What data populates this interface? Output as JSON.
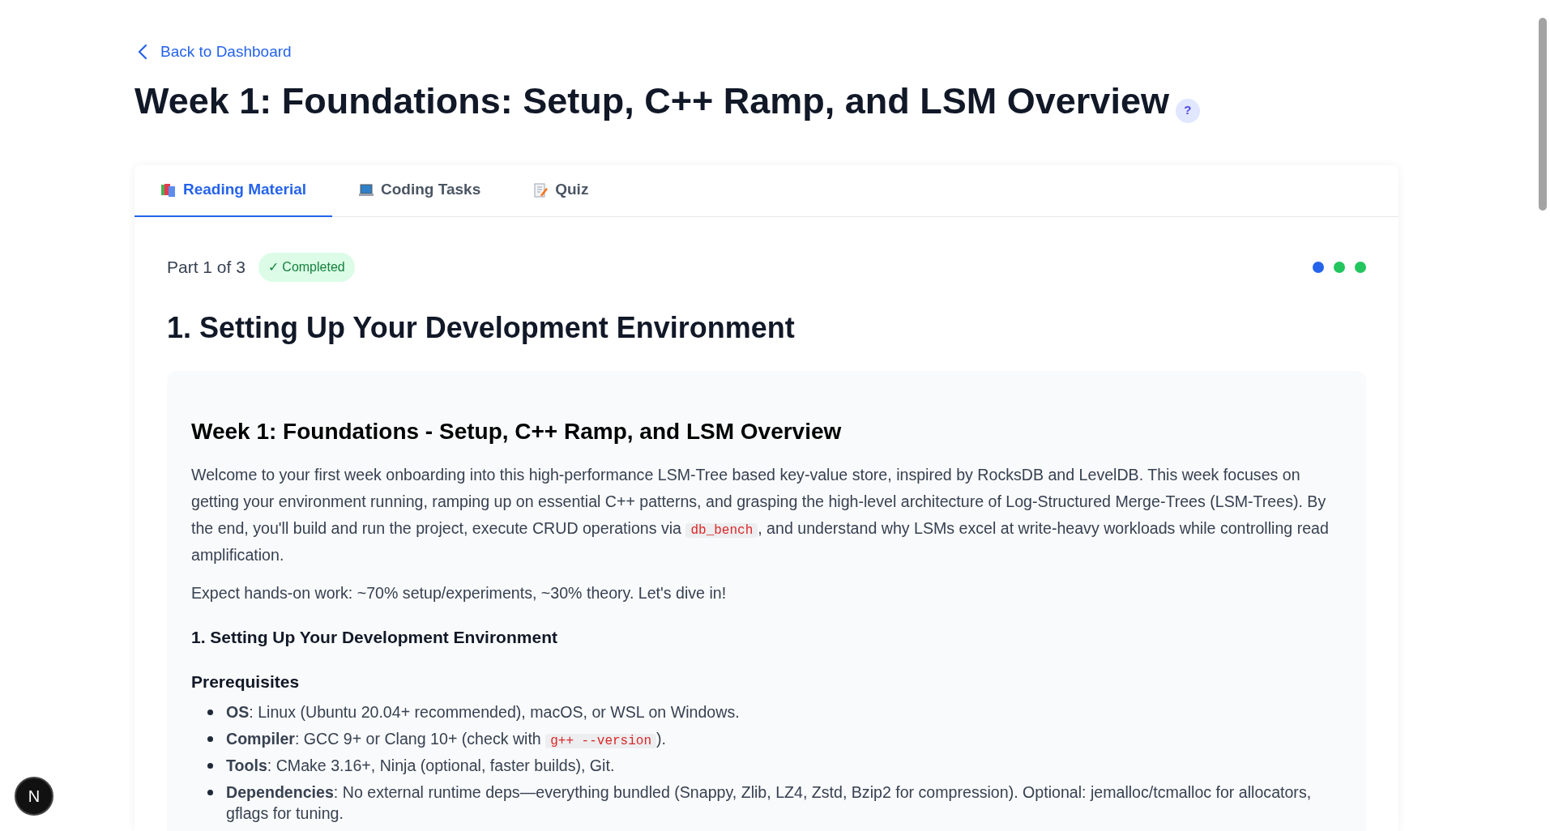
{
  "back_link": "Back to Dashboard",
  "title": "Week 1: Foundations: Setup, C++ Ramp, and LSM Overview",
  "help_badge": "?",
  "tabs": [
    {
      "label": "Reading Material",
      "kind": "books",
      "selected": true
    },
    {
      "label": "Coding Tasks",
      "kind": "laptop",
      "selected": false
    },
    {
      "label": "Quiz",
      "kind": "memo",
      "selected": false
    }
  ],
  "part": {
    "label": "Part 1 of 3",
    "status": "✓ Completed",
    "completed": true
  },
  "part_dots": [
    {
      "color": "#2563eb"
    },
    {
      "color": "#22c55e"
    },
    {
      "color": "#22c55e"
    }
  ],
  "section_title": "1. Setting Up Your Development Environment",
  "content": [
    {
      "kind": "h2",
      "segments": [
        {
          "kind": "text",
          "text": "Week 1: Foundations - Setup, C++ Ramp, and LSM Overview"
        }
      ]
    },
    {
      "kind": "p",
      "segments": [
        {
          "kind": "text",
          "text": "Welcome to your first week onboarding into this high-performance LSM-Tree based key-value store, inspired by RocksDB and LevelDB. This week focuses on getting your environment running, ramping up on essential C++ patterns, and grasping the high-level architecture of Log-Structured Merge-Trees (LSM-Trees). By the end, you'll build and run the project, execute CRUD operations via "
        },
        {
          "kind": "code",
          "text": "db_bench"
        },
        {
          "kind": "text",
          "text": ", and understand why LSMs excel at write-heavy workloads while controlling read amplification."
        }
      ]
    },
    {
      "kind": "p",
      "segments": [
        {
          "kind": "text",
          "text": "Expect hands-on work: ~70% setup/experiments, ~30% theory. Let's dive in!"
        }
      ]
    },
    {
      "kind": "h3",
      "segments": [
        {
          "kind": "text",
          "text": "1. Setting Up Your Development Environment"
        }
      ]
    },
    {
      "kind": "h4",
      "segments": [
        {
          "kind": "text",
          "text": "Prerequisites"
        }
      ]
    },
    {
      "kind": "li",
      "segments": [
        {
          "kind": "text",
          "text": "**OS**: Linux (Ubuntu 20.04+ recommended), macOS, or WSL on Windows."
        }
      ]
    },
    {
      "kind": "li",
      "segments": [
        {
          "kind": "text",
          "text": "**Compiler**: GCC 9+ or Clang 10+ (check with "
        },
        {
          "kind": "code",
          "text": "g++ --version"
        },
        {
          "kind": "text",
          "text": ")."
        }
      ]
    },
    {
      "kind": "li",
      "segments": [
        {
          "kind": "text",
          "text": "**Tools**: CMake 3.16+, Ninja (optional, faster builds), Git."
        }
      ]
    },
    {
      "kind": "li",
      "segments": [
        {
          "kind": "text",
          "text": "**Dependencies**: No external runtime deps—everything bundled (Snappy, Zlib, LZ4, Zstd, Bzip2 for compression). Optional: jemalloc/tcmalloc for allocators, gflags for tuning."
        }
      ]
    }
  ],
  "corner_badge": "N"
}
